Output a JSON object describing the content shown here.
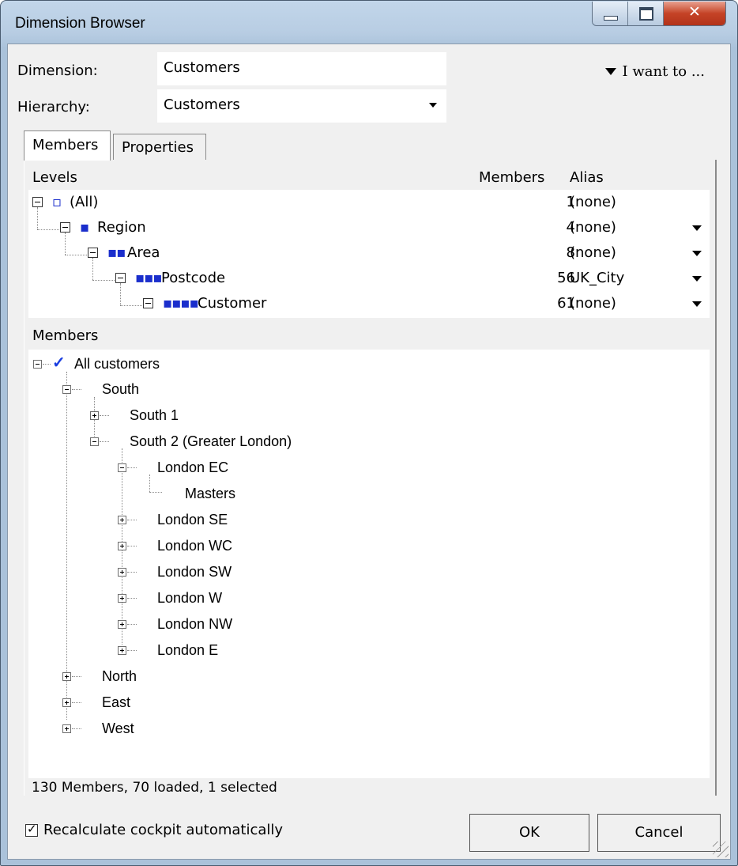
{
  "window": {
    "title": "Dimension Browser"
  },
  "form": {
    "dimension_label": "Dimension:",
    "dimension_value": "Customers",
    "hierarchy_label": "Hierarchy:",
    "hierarchy_value": "Customers",
    "i_want_to": "I want to ..."
  },
  "tabs": [
    {
      "label": "Members",
      "active": true
    },
    {
      "label": "Properties",
      "active": false
    }
  ],
  "levels": {
    "header_levels": "Levels",
    "header_members": "Members",
    "header_alias": "Alias",
    "rows": [
      {
        "dots": "▫",
        "name": "(All)",
        "count": "1",
        "alias": "(none)"
      },
      {
        "dots": "▪",
        "name": "Region",
        "count": "4",
        "alias": "(none)"
      },
      {
        "dots": "▪▪",
        "name": "Area",
        "count": "8",
        "alias": "(none)"
      },
      {
        "dots": "▪▪▪",
        "name": "Postcode",
        "count": "56",
        "alias": "UK_City"
      },
      {
        "dots": "▪▪▪▪",
        "name": "Customer",
        "count": "61",
        "alias": "(none)"
      }
    ]
  },
  "members": {
    "header": "Members",
    "root": "All customers",
    "south": "South",
    "south1": "South 1",
    "south2": "South 2 (Greater London)",
    "london_ec": "London EC",
    "masters": "Masters",
    "london_se": "London SE",
    "london_wc": "London WC",
    "london_sw": "London SW",
    "london_w": "London W",
    "london_nw": "London NW",
    "london_e": "London E",
    "north": "North",
    "east": "East",
    "west": "West"
  },
  "status": "130 Members, 70 loaded, 1 selected",
  "footer": {
    "recalc_label": "Recalculate cockpit automatically",
    "recalc_checked": true,
    "ok_label": "OK",
    "cancel_label": "Cancel"
  },
  "icons": [
    "minimize-icon",
    "maximize-icon",
    "close-icon",
    "dropdown-arrow-icon",
    "checkmark-icon",
    "expand-icon",
    "collapse-icon",
    "level-dots-icon",
    "resize-grip-icon"
  ]
}
